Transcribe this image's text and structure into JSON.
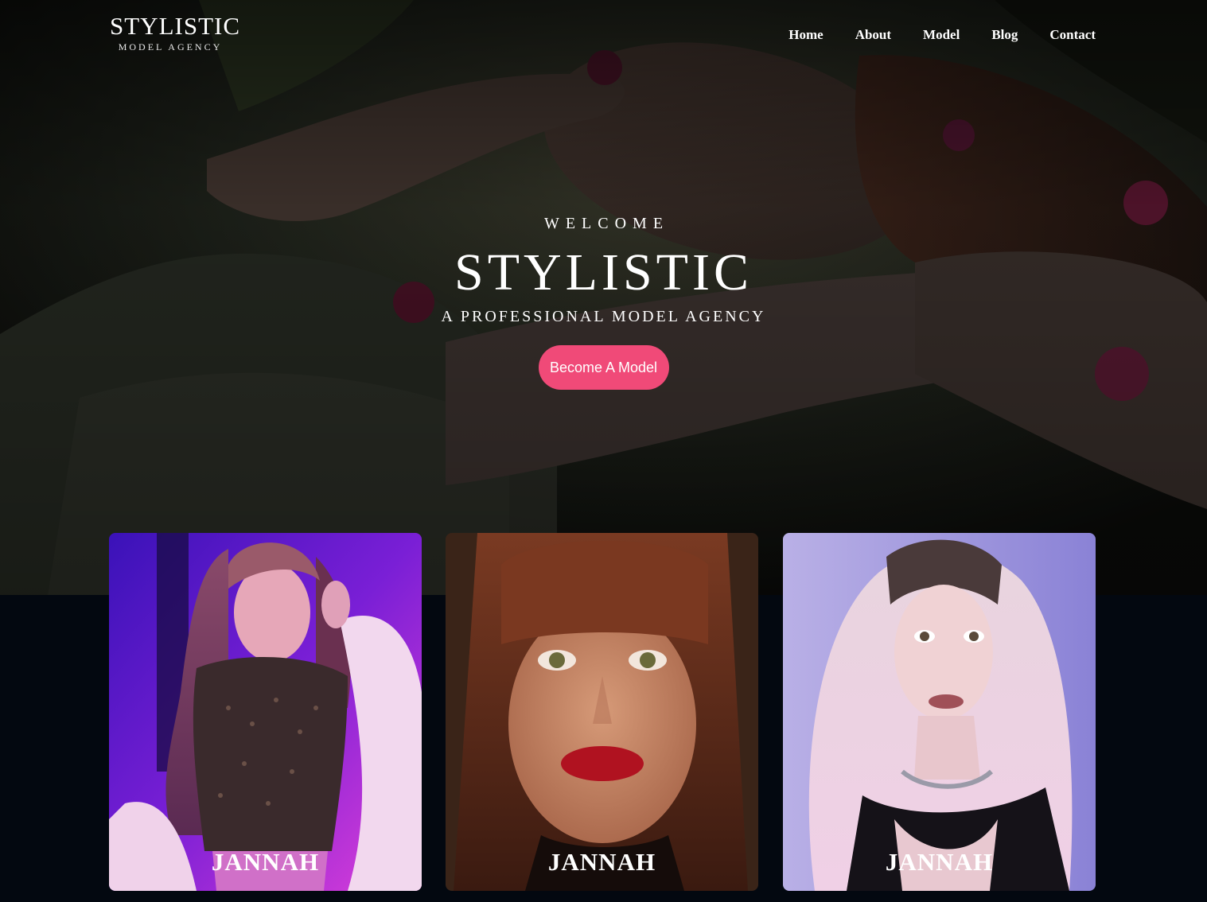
{
  "brand": {
    "title": "STYLISTIC",
    "subtitle": "MODEL AGENCY"
  },
  "nav": {
    "items": [
      {
        "label": "Home"
      },
      {
        "label": "About"
      },
      {
        "label": "Model"
      },
      {
        "label": "Blog"
      },
      {
        "label": "Contact"
      }
    ]
  },
  "hero": {
    "welcome": "WELCOME",
    "title": "STYLISTIC",
    "subtitle": "A PROFESSIONAL MODEL AGENCY",
    "cta_label": "Become A Model"
  },
  "models": [
    {
      "name": "JANNAH"
    },
    {
      "name": "JANNAH"
    },
    {
      "name": "JANNAH"
    }
  ],
  "colors": {
    "accent": "#f04a78",
    "background": "#030810"
  }
}
